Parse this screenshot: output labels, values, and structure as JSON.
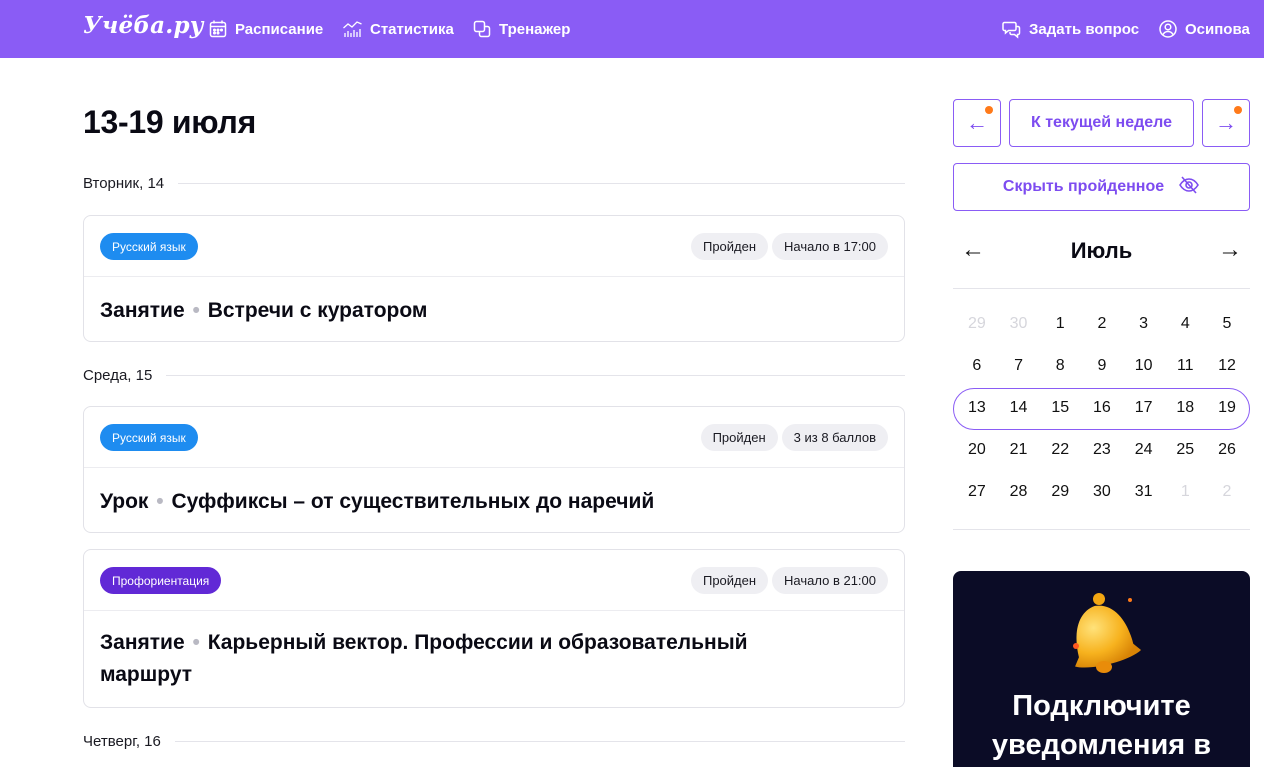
{
  "nav": {
    "logo": "Учёба.ру",
    "items": [
      {
        "label": "Расписание",
        "icon": "calendar-icon"
      },
      {
        "label": "Статистика",
        "icon": "stats-icon"
      },
      {
        "label": "Тренажер",
        "icon": "trainer-icon"
      }
    ],
    "ask": {
      "label": "Задать вопрос",
      "icon": "chat-icon"
    },
    "user": {
      "label": "Осипова",
      "icon": "user-icon"
    }
  },
  "colors": {
    "accent": "#8a5cf5",
    "notification": "#ff7a1a",
    "tag_blue": "#1e8cf0",
    "tag_purple": "#6129d6",
    "promo_bg": "#0b0c26"
  },
  "schedule": {
    "title": "13-19 июля",
    "days": [
      {
        "label": "Вторник, 14"
      },
      {
        "label": "Среда, 15"
      },
      {
        "label": "Четверг, 16"
      }
    ],
    "items": [
      {
        "tag": "Русский язык",
        "status": "Пройден",
        "info": "Начало в 17:00",
        "kind": "Занятие",
        "separator": "•",
        "title": "Встречи с куратором"
      },
      {
        "tag": "Русский язык",
        "status": "Пройден",
        "info": "3 из 8 баллов",
        "kind": "Урок",
        "separator": "•",
        "title": "Суффиксы – от существительных до наречий"
      },
      {
        "tag": "Профориентация",
        "status": "Пройден",
        "info": "Начало в 21:00",
        "kind": "Занятие",
        "separator": "•",
        "title": "Карьерный вектор. Профессии и образовательный маршрут"
      }
    ]
  },
  "sidebar": {
    "prev_arrow": "←",
    "next_arrow": "→",
    "current_week": "К текущей неделе",
    "hide_done": "Скрыть пройденное",
    "calendar": {
      "month": "Июль",
      "prev": "←",
      "next": "→",
      "weeks": [
        [
          "29",
          "30",
          "1",
          "2",
          "3",
          "4",
          "5"
        ],
        [
          "6",
          "7",
          "8",
          "9",
          "10",
          "11",
          "12"
        ],
        [
          "13",
          "14",
          "15",
          "16",
          "17",
          "18",
          "19"
        ],
        [
          "20",
          "21",
          "22",
          "23",
          "24",
          "25",
          "26"
        ],
        [
          "27",
          "28",
          "29",
          "30",
          "31",
          "1",
          "2"
        ]
      ]
    },
    "promo": "Подключите уведомления в"
  }
}
